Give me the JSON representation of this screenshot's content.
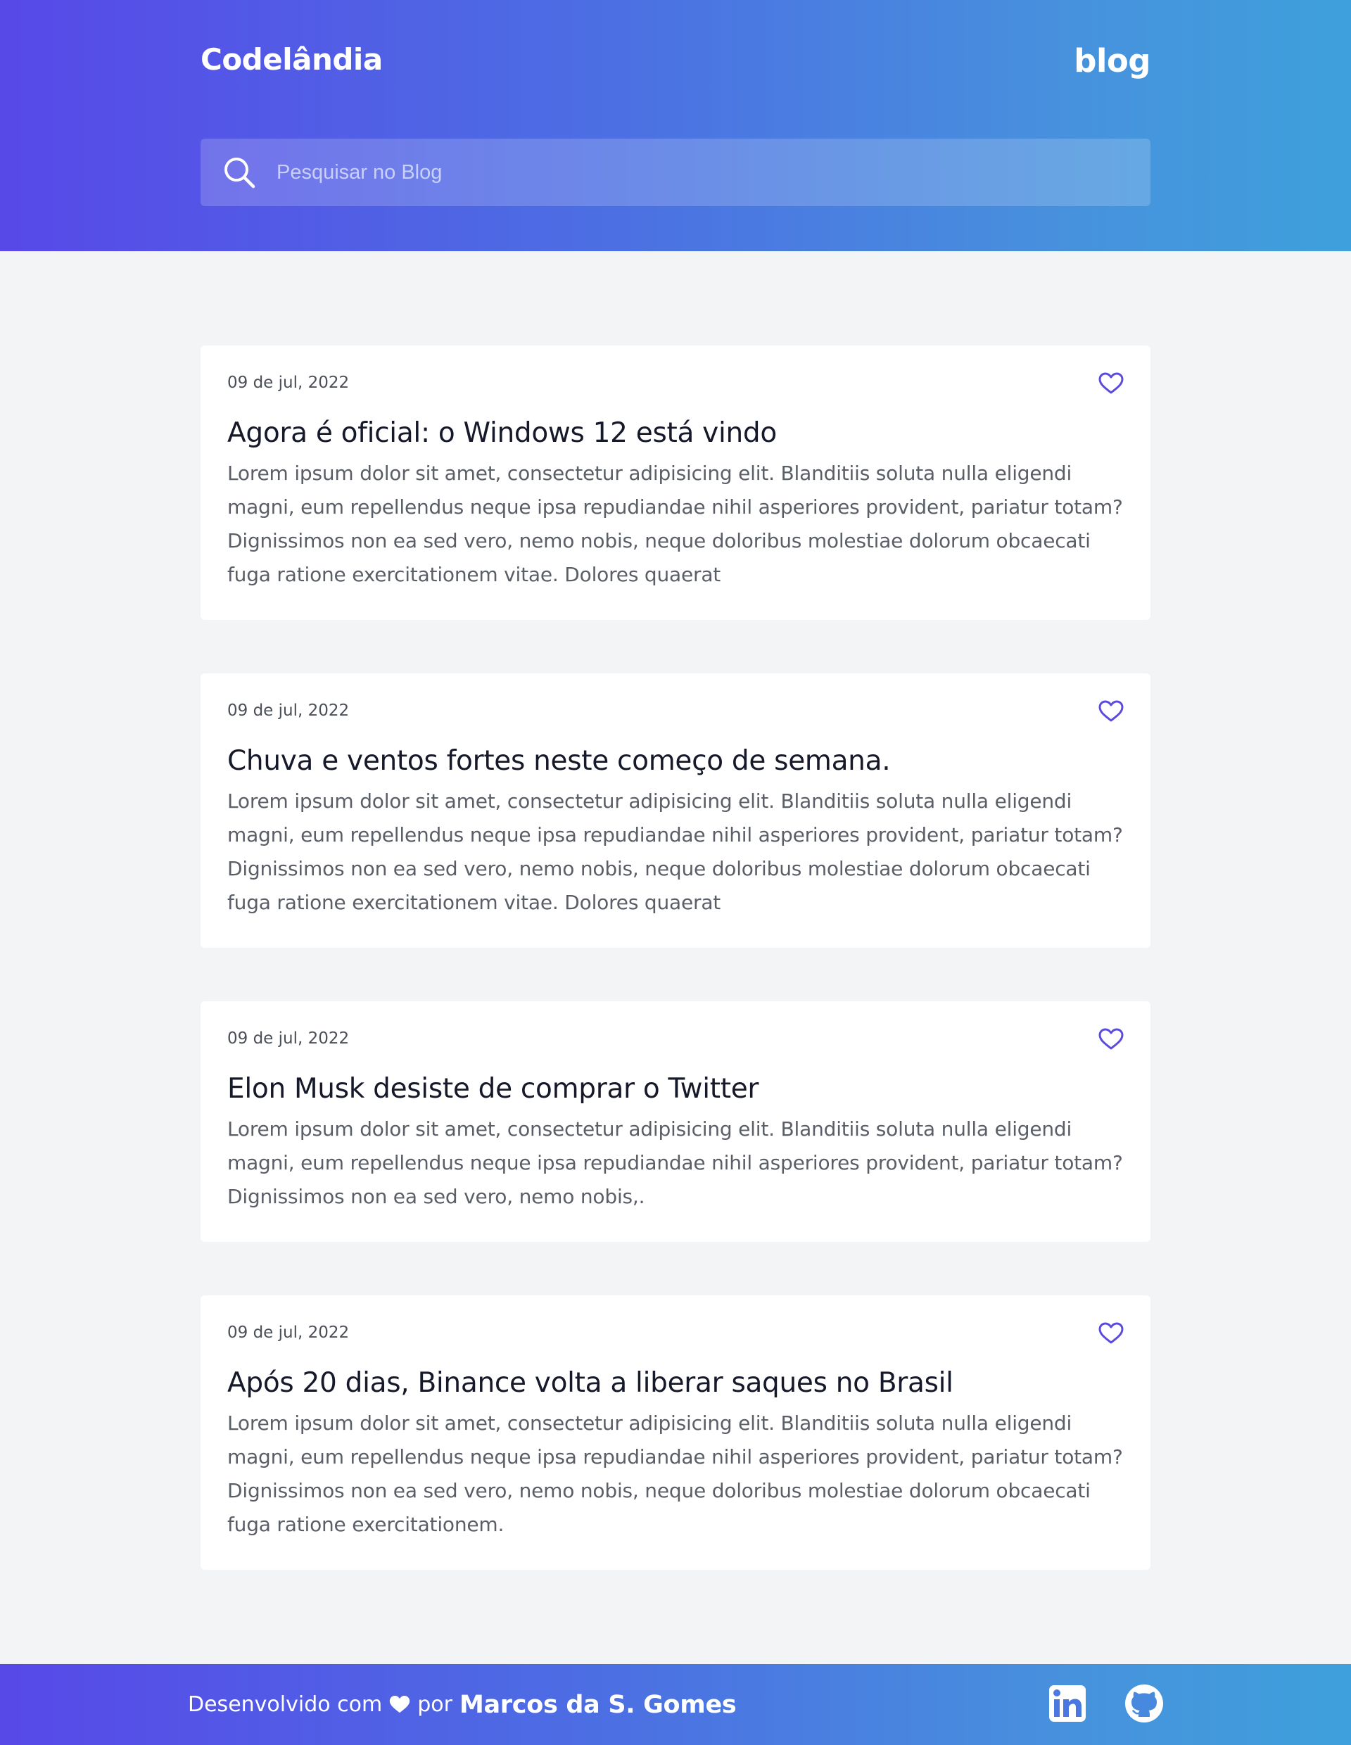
{
  "header": {
    "brand": "Codelândia",
    "nav_link": "blog",
    "search_placeholder": "Pesquisar no Blog"
  },
  "posts": [
    {
      "date": "09 de jul, 2022",
      "title": "Agora é oficial: o Windows 12 está vindo",
      "body": "Lorem ipsum dolor sit amet, consectetur adipisicing elit. Blanditiis soluta nulla eligendi magni, eum repellendus neque ipsa repudiandae nihil asperiores provident, pariatur totam? Dignissimos non ea sed vero, nemo nobis, neque doloribus molestiae dolorum obcaecati fuga ratione exercitationem vitae. Dolores quaerat"
    },
    {
      "date": "09 de jul, 2022",
      "title": "Chuva e ventos fortes neste começo de semana.",
      "body": "Lorem ipsum dolor sit amet, consectetur adipisicing elit. Blanditiis soluta nulla eligendi magni, eum repellendus neque ipsa repudiandae nihil asperiores provident, pariatur totam? Dignissimos non ea sed vero, nemo nobis, neque doloribus molestiae dolorum obcaecati fuga ratione exercitationem vitae. Dolores quaerat"
    },
    {
      "date": "09 de jul, 2022",
      "title": "Elon Musk desiste de comprar o Twitter",
      "body": "Lorem ipsum dolor sit amet, consectetur adipisicing elit. Blanditiis soluta nulla eligendi magni, eum repellendus neque ipsa repudiandae nihil asperiores provident, pariatur totam? Dignissimos non ea sed vero, nemo nobis,."
    },
    {
      "date": "09 de jul, 2022",
      "title": "Após 20 dias, Binance volta a liberar saques no Brasil",
      "body": "Lorem ipsum dolor sit amet, consectetur adipisicing elit. Blanditiis soluta nulla eligendi magni, eum repellendus neque ipsa repudiandae nihil asperiores provident, pariatur totam? Dignissimos non ea sed vero, nemo nobis, neque doloribus molestiae dolorum obcaecati fuga ratione exercitationem."
    }
  ],
  "footer": {
    "credit_prefix": "Desenvolvido com",
    "credit_middle": "por",
    "author": "Marcos da S. Gomes",
    "icons": [
      "heart-icon",
      "linkedin-icon",
      "github-icon"
    ]
  },
  "colors": {
    "gradient_start": "#5748e8",
    "gradient_end": "#3ea0dc",
    "accent": "#5a4bdc",
    "page_background": "#f3f4f6",
    "card_background": "#ffffff"
  }
}
